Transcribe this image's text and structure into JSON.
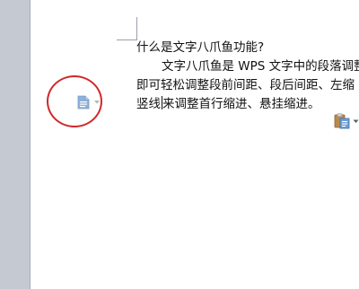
{
  "document": {
    "lines": [
      "什么是文字八爪鱼功能?",
      "文字八爪鱼是 WPS 文字中的段落调整",
      "即可轻松调整段前间距、段后间距、左缩",
      "竖线",
      "来调整首行缩进、悬挂缩进。"
    ]
  },
  "icons": {
    "paragraph_options": "paragraph-layout-icon",
    "paragraph_dropdown": "chevron-down-icon",
    "paste_options": "clipboard-paste-icon",
    "paste_dropdown": "chevron-down-icon"
  },
  "colors": {
    "annotation_circle": "#d0282a",
    "icon_blue": "#8fb0d8",
    "gutter": "#c4c9d2"
  }
}
